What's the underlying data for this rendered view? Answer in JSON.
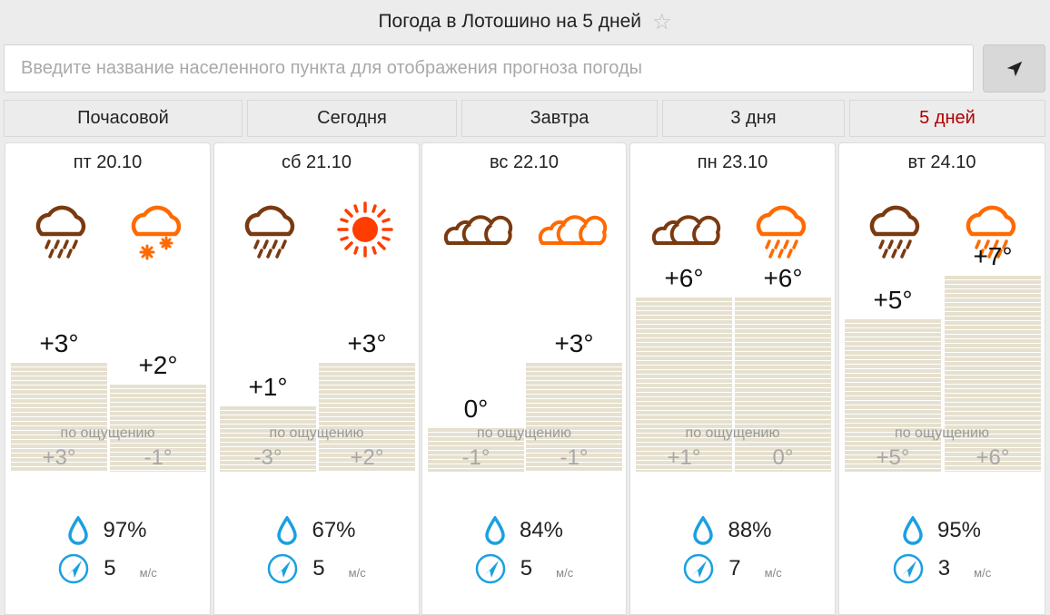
{
  "header": {
    "title": "Погода в Лотошино на 5 дней",
    "star_icon": "star-outline-icon"
  },
  "search": {
    "placeholder": "Введите название населенного пункта для отображения прогноза погоды",
    "value": "",
    "locate_icon": "location-arrow-icon"
  },
  "tabs": [
    {
      "label": "Почасовой",
      "active": false
    },
    {
      "label": "Сегодня",
      "active": false
    },
    {
      "label": "Завтра",
      "active": false
    },
    {
      "label": "3 дня",
      "active": false
    },
    {
      "label": "5 дней",
      "active": true
    }
  ],
  "feels_like_caption": "по ощущению",
  "colors": {
    "night_icon": "#7a3a10",
    "day_icon": "#ff6a00",
    "sun": "#ff3d00",
    "active_tab": "#b00000",
    "water_icon": "#1c9fe2",
    "temp_bar": "#e6e0cf"
  },
  "days": [
    {
      "label": "пт 20.10",
      "night_icon": "cloud-rain-icon",
      "day_icon": "cloud-snow-icon",
      "night_temp": "+3°",
      "day_temp": "+2°",
      "night_feels": "+3°",
      "day_feels": "-1°",
      "humidity": "97%",
      "wind_speed": "5",
      "wind_unit": "м/с"
    },
    {
      "label": "сб 21.10",
      "night_icon": "cloud-rain-icon",
      "day_icon": "sun-icon",
      "night_temp": "+1°",
      "day_temp": "+3°",
      "night_feels": "-3°",
      "day_feels": "+2°",
      "humidity": "67%",
      "wind_speed": "5",
      "wind_unit": "м/с"
    },
    {
      "label": "вс 22.10",
      "night_icon": "overcast-clouds-icon",
      "day_icon": "overcast-clouds-icon",
      "night_temp": "0°",
      "day_temp": "+3°",
      "night_feels": "-1°",
      "day_feels": "-1°",
      "humidity": "84%",
      "wind_speed": "5",
      "wind_unit": "м/с"
    },
    {
      "label": "пн 23.10",
      "night_icon": "overcast-clouds-icon",
      "day_icon": "cloud-rain-icon",
      "night_temp": "+6°",
      "day_temp": "+6°",
      "night_feels": "+1°",
      "day_feels": "0°",
      "humidity": "88%",
      "wind_speed": "7",
      "wind_unit": "м/с"
    },
    {
      "label": "вт 24.10",
      "night_icon": "cloud-rain-icon",
      "day_icon": "cloud-rain-icon",
      "night_temp": "+5°",
      "day_temp": "+7°",
      "night_feels": "+5°",
      "day_feels": "+6°",
      "humidity": "95%",
      "wind_speed": "3",
      "wind_unit": "м/с"
    }
  ]
}
